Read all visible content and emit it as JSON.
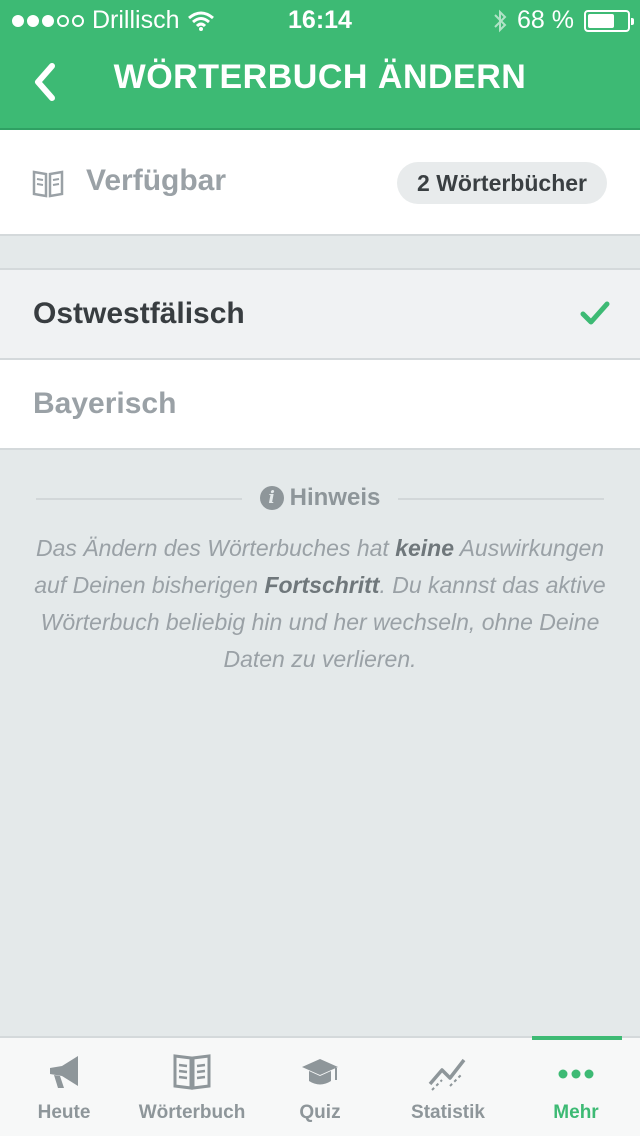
{
  "status_bar": {
    "carrier": "Drillisch",
    "time": "16:14",
    "battery": "68 %",
    "battery_level": 0.68,
    "signal_bars_filled": 3,
    "signal_bars_total": 5
  },
  "header": {
    "title": "WÖRTERBUCH ÄNDERN",
    "back_icon": "chevron-left-icon"
  },
  "available": {
    "icon": "book-icon",
    "label": "Verfügbar",
    "badge": "2 Wörterbücher"
  },
  "dictionaries": [
    {
      "label": "Ostwestfälisch",
      "selected": true
    },
    {
      "label": "Bayerisch",
      "selected": false
    }
  ],
  "hint": {
    "title": "Hinweis",
    "part1": "Das Ändern des Wörterbuches hat ",
    "bold1": "keine",
    "part2": " Auswirkungen auf Deinen bisherigen ",
    "bold2": "Fortschritt",
    "part3": ". Du kannst das aktive Wörterbuch beliebig hin und her wechseln, ohne Deine Daten zu verlieren."
  },
  "tabs": [
    {
      "label": "Heute",
      "icon": "megaphone-icon",
      "active": false
    },
    {
      "label": "Wörterbuch",
      "icon": "book-icon",
      "active": false
    },
    {
      "label": "Quiz",
      "icon": "graduation-cap-icon",
      "active": false
    },
    {
      "label": "Statistik",
      "icon": "chart-line-icon",
      "active": false
    },
    {
      "label": "Mehr",
      "icon": "more-dots-icon",
      "active": true
    }
  ],
  "colors": {
    "accent": "#3dba74",
    "background": "#e4e9ea",
    "text_dark": "#383d40",
    "text_muted": "#9aa1a6"
  }
}
